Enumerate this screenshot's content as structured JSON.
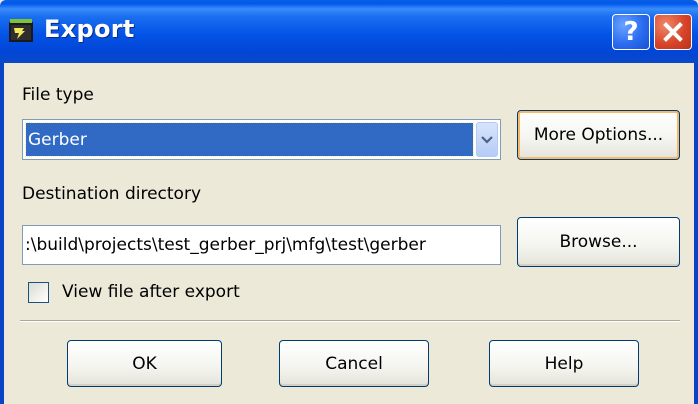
{
  "window": {
    "title": "Export",
    "help_button": "?",
    "close_button": "close"
  },
  "file_type": {
    "label": "File type",
    "selected": "Gerber"
  },
  "more_options_button": "More Options...",
  "destination": {
    "label": "Destination directory",
    "value": ":\\build\\projects\\test_gerber_prj\\mfg\\test\\gerber"
  },
  "browse_button": "Browse...",
  "view_after_export": {
    "label": "View file after export",
    "checked": false
  },
  "buttons": {
    "ok": "OK",
    "cancel": "Cancel",
    "help": "Help"
  },
  "icons": {
    "app": "export-app-icon",
    "dropdown": "chevron-down-icon",
    "close": "close-icon"
  }
}
